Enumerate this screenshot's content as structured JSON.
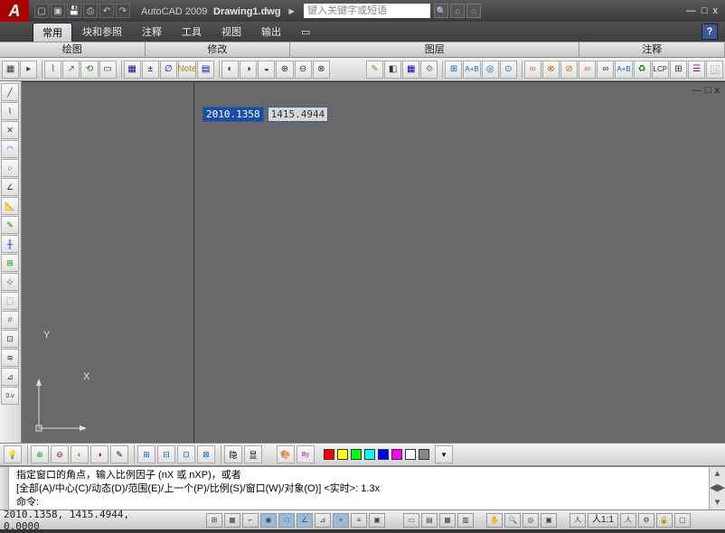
{
  "title": {
    "app": "AutoCAD 2009",
    "doc": "Drawing1.dwg",
    "arrow": "►"
  },
  "search": {
    "placeholder": "键入关键字或短语"
  },
  "menu": {
    "tabs": [
      "常用",
      "块和参照",
      "注释",
      "工具",
      "视图",
      "输出"
    ],
    "help": "?"
  },
  "panels": [
    "绘图",
    "修改",
    "图层",
    "注释"
  ],
  "doc_ctrl": {
    "min": "—",
    "max": "□",
    "close": "x"
  },
  "coord": {
    "x": "2010.1358",
    "y": "1415.4944"
  },
  "ucs": {
    "x": "X",
    "y": "Y"
  },
  "layer": {
    "hide": "隐",
    "show": "显"
  },
  "swatches": [
    "#ff0000",
    "#ffff00",
    "#00ff00",
    "#00ffff",
    "#0000ff",
    "#ff00ff",
    "#ffffff",
    "#888888"
  ],
  "cmd": {
    "line1": "指定窗口的角点，输入比例因子 (nX 或 nXP)，或者",
    "line2": "[全部(A)/中心(C)/动态(D)/范围(E)/上一个(P)/比例(S)/窗口(W)/对象(O)] <实时>: 1.3x",
    "prompt": "命令:"
  },
  "status": {
    "coord": "2010.1358, 1415.4944, 0.0000",
    "scale": "人1:1",
    "ann": "人"
  }
}
